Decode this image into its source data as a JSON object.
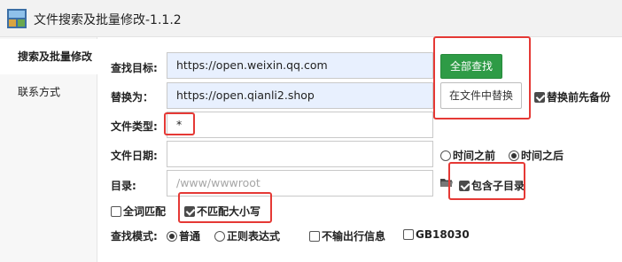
{
  "window": {
    "title": "文件搜索及批量修改-1.1.2",
    "icon": "app-icon"
  },
  "sidebar": {
    "items": [
      {
        "label": "搜索及批量修改",
        "active": true
      },
      {
        "label": "联系方式",
        "active": false
      }
    ]
  },
  "form": {
    "search_target": {
      "label": "查找目标:",
      "value": "https://open.weixin.qq.com"
    },
    "replace_with": {
      "label": "替换为：",
      "value": "https://open.qianli2.shop"
    },
    "file_type": {
      "label": "文件类型:",
      "value": "*"
    },
    "file_date": {
      "label": "文件日期:",
      "value": ""
    },
    "directory": {
      "label": "目录:",
      "placeholder": "/www/wwwroot"
    },
    "search_mode_label": "查找模式:"
  },
  "buttons": {
    "find_all": "全部查找",
    "replace_in_files": "在文件中替换"
  },
  "options": {
    "backup_before_replace": {
      "label": "替换前先备份",
      "checked": true
    },
    "date_before": {
      "label": "时间之前",
      "selected": false
    },
    "date_after": {
      "label": "时间之后",
      "selected": true
    },
    "include_subdirs": {
      "label": "包含子目录",
      "checked": true
    },
    "whole_word": {
      "label": "全词匹配",
      "checked": false
    },
    "ignore_case": {
      "label": "不匹配大小写",
      "checked": true
    },
    "mode_normal": {
      "label": "普通",
      "selected": true
    },
    "mode_regex": {
      "label": "正则表达式",
      "selected": false
    },
    "no_line_output": {
      "label": "不输出行信息",
      "checked": false
    },
    "gb18030": {
      "label": "GB18030",
      "checked": false
    }
  },
  "colors": {
    "accent_green": "#2e9b46",
    "highlight_red": "#e53935",
    "input_blue": "#e8f0fe"
  }
}
